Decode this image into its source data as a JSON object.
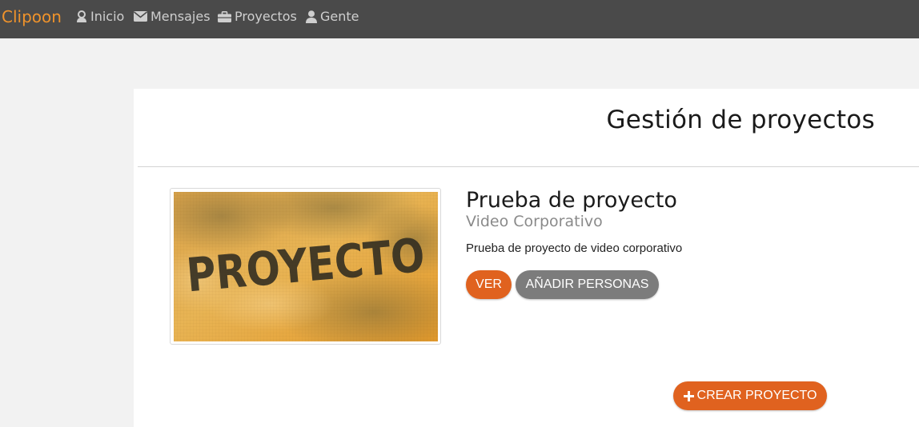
{
  "navbar": {
    "brand": "Clipoon",
    "items": [
      {
        "label": "Inicio",
        "icon": "user-badge-icon"
      },
      {
        "label": "Mensajes",
        "icon": "envelope-icon"
      },
      {
        "label": "Proyectos",
        "icon": "briefcase-icon"
      },
      {
        "label": "Gente",
        "icon": "person-icon"
      }
    ]
  },
  "main": {
    "title": "Gestión de proyectos",
    "project": {
      "title": "Prueba de proyecto",
      "subtitle": "Video Corporativo",
      "description": "Prueba de proyecto de video corporativo",
      "image_text": "PROYECTO",
      "view_label": "VER",
      "add_people_label": "AÑADIR PERSONAS"
    },
    "create_label": "CREAR PROYECTO"
  },
  "colors": {
    "accent": "#e0621f",
    "brand": "#f0932b",
    "navbar_bg": "#4a4a4a",
    "secondary_button": "#7c7c7c"
  }
}
